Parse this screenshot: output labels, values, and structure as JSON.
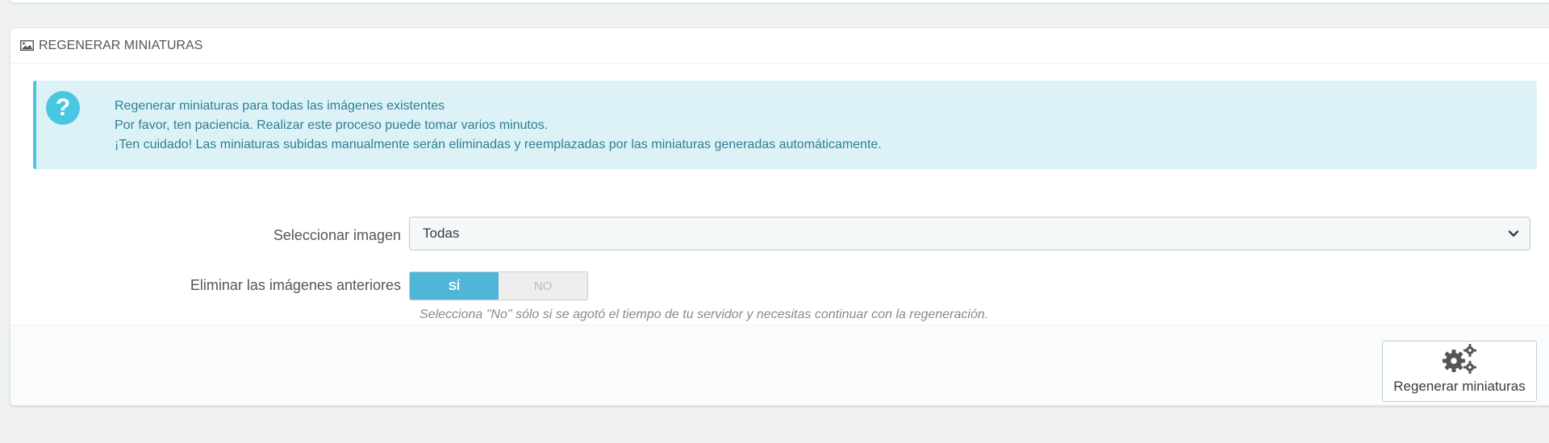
{
  "panel": {
    "title": "REGENERAR MINIATURAS",
    "title_icon": "picture-icon"
  },
  "alert": {
    "icon": "question-icon",
    "icon_glyph": "?",
    "lines": [
      "Regenerar miniaturas para todas las imágenes existentes",
      "Por favor, ten paciencia. Realizar este proceso puede tomar varios minutos.",
      "¡Ten cuidado! Las miniaturas subidas manualmente serán eliminadas y reemplazadas por las miniaturas generadas automáticamente."
    ]
  },
  "form": {
    "select_label": "Seleccionar imagen",
    "select_value": "Todas",
    "delete_label": "Eliminar las imágenes anteriores",
    "switch_yes": "SÍ",
    "switch_no": "NO",
    "switch_selected": "yes",
    "help_text": "Selecciona \"No\" sólo si se agotó el tiempo de tu servidor y necesitas continuar con la regeneración."
  },
  "footer": {
    "button_label": "Regenerar miniaturas",
    "button_icon": "cogs-icon"
  },
  "colors": {
    "alert_bg": "#dcf2f7",
    "alert_accent": "#4ac7e0",
    "alert_text": "#2f7f93",
    "switch_active": "#4fb6d8"
  }
}
